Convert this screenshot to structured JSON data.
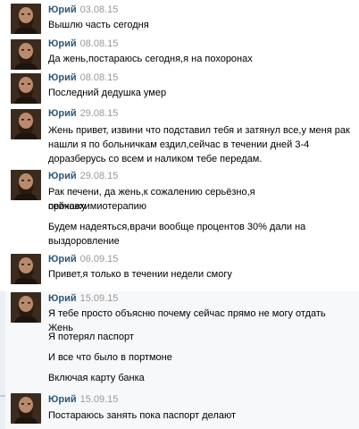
{
  "sender": "Юрий",
  "messages": [
    {
      "date": "03.08.15",
      "lines": [
        "Вышлю часть сегодня"
      ]
    },
    {
      "date": "08.08.15",
      "lines": [
        "Да жень,постараюсь сегодня,я на похоронах"
      ]
    },
    {
      "date": "08.08.15",
      "lines": [
        "Последний дедушка умер"
      ]
    },
    {
      "date": "29.08.15",
      "lines": [
        "Жень привет, извини что подставил тебя и затянул все,у меня рак",
        "нашли я по больничкам ездил,сейчас в течении дней 3-4",
        "доразберусь со всем и наликом тебе передам."
      ]
    },
    {
      "date": "29.08.15",
      "lines": [
        "Рак печени, да жень,к сожалению серьёзно,я сейчасхимиотерапию",
        "прохожу",
        "Будем надеяться,врачи вообще процентов 30% дали на",
        "выздоровление"
      ]
    },
    {
      "date": "06.09.15",
      "lines": [
        "Привет,я только в течении недели смогу"
      ]
    },
    {
      "date": "15.09.15",
      "lines": [
        "Я тебе просто объясню почему сейчас прямо не могу отдать Жень",
        "Я потерял паспорт",
        "И все что было в портмоне",
        "Включая карту банка"
      ]
    },
    {
      "date": "15.09.15",
      "lines": [
        "Постараюсь занять пока паспорт делают"
      ]
    }
  ]
}
